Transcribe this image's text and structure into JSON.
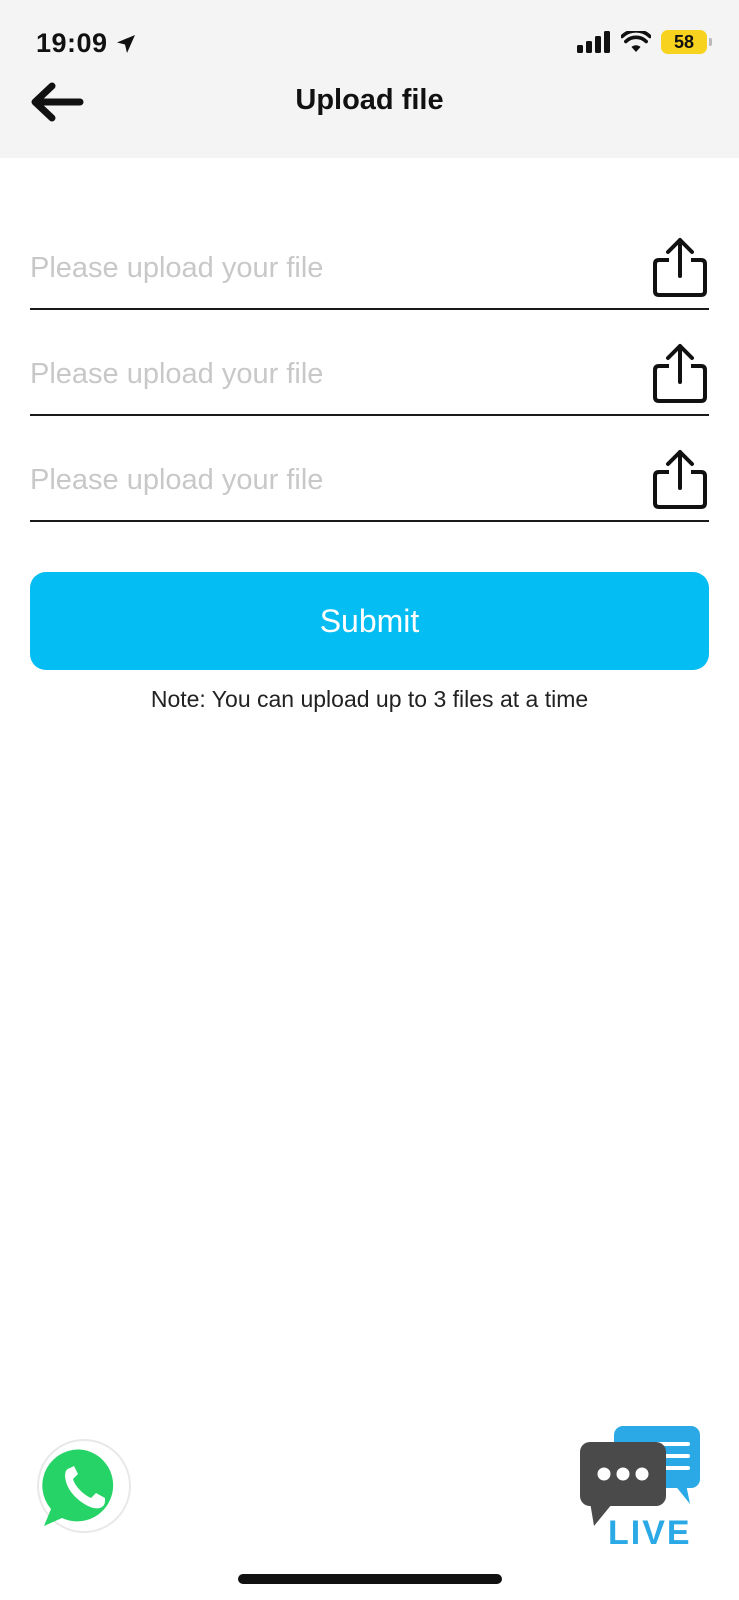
{
  "status_bar": {
    "time": "19:09",
    "battery": "58",
    "battery_color": "#f7d21e"
  },
  "header": {
    "title": "Upload file",
    "back_icon": "arrow-left-icon"
  },
  "upload_fields": [
    {
      "placeholder": "Please upload your file",
      "icon": "share-upload-icon"
    },
    {
      "placeholder": "Please upload your file",
      "icon": "share-upload-icon"
    },
    {
      "placeholder": "Please upload your file",
      "icon": "share-upload-icon"
    }
  ],
  "submit": {
    "label": "Submit",
    "color": "#04bdf2"
  },
  "note": "Note: You can upload up to 3 files at a time",
  "floating": {
    "whatsapp_icon": "whatsapp-icon",
    "live_chat_label": "LIVE",
    "live_chat_icon": "live-chat-icon"
  }
}
